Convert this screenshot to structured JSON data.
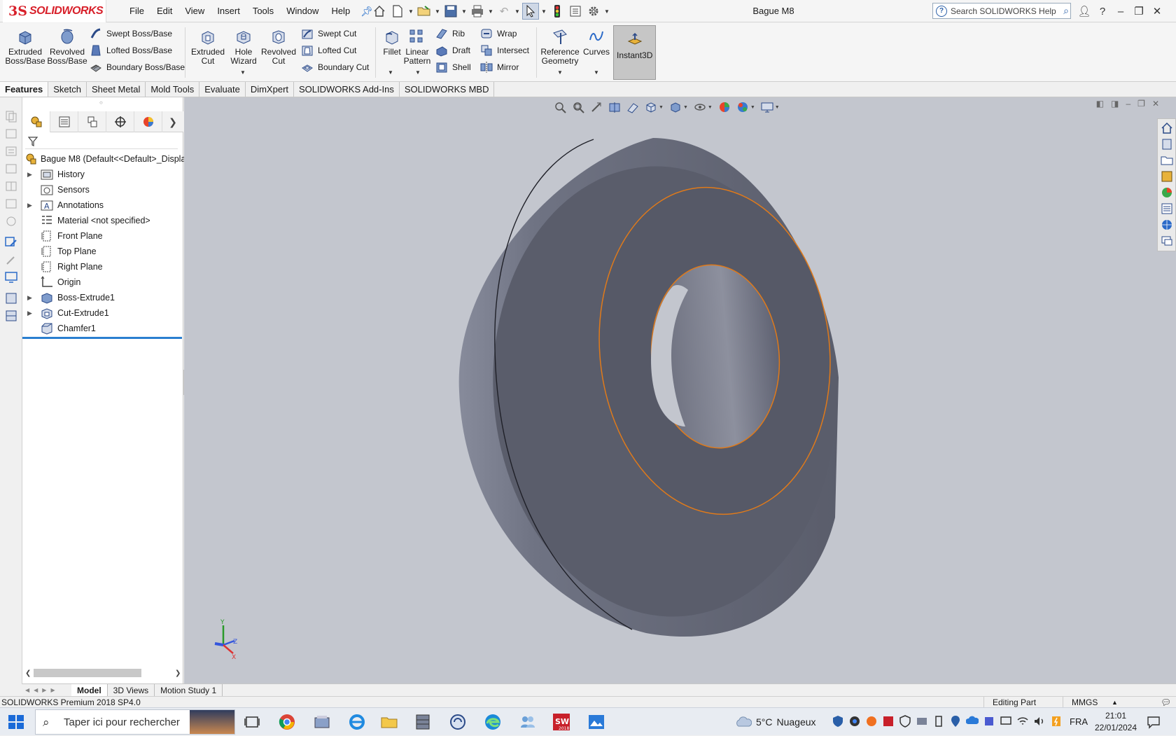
{
  "app": {
    "logo_ds": "3S",
    "logo_text": "SOLIDWORKS",
    "document_title": "Bague M8",
    "search_placeholder": "Search SOLIDWORKS Help"
  },
  "menu": [
    "File",
    "Edit",
    "View",
    "Insert",
    "Tools",
    "Window",
    "Help"
  ],
  "ribbon": {
    "extruded_boss": "Extruded Boss/Base",
    "revolved_boss": "Revolved Boss/Base",
    "swept_boss": "Swept Boss/Base",
    "lofted_boss": "Lofted Boss/Base",
    "boundary_boss": "Boundary Boss/Base",
    "extruded_cut": "Extruded Cut",
    "hole_wizard": "Hole Wizard",
    "revolved_cut": "Revolved Cut",
    "swept_cut": "Swept Cut",
    "lofted_cut": "Lofted Cut",
    "boundary_cut": "Boundary Cut",
    "fillet": "Fillet",
    "linear_pattern": "Linear Pattern",
    "rib": "Rib",
    "draft": "Draft",
    "shell": "Shell",
    "wrap": "Wrap",
    "intersect": "Intersect",
    "mirror": "Mirror",
    "reference_geometry": "Reference Geometry",
    "curves": "Curves",
    "instant3d": "Instant3D"
  },
  "tabs": [
    "Features",
    "Sketch",
    "Sheet Metal",
    "Mold Tools",
    "Evaluate",
    "DimXpert",
    "SOLIDWORKS Add-Ins",
    "SOLIDWORKS MBD"
  ],
  "tree": {
    "root": "Bague M8  (Default<<Default>_Displa",
    "items": [
      {
        "label": "History",
        "expandable": true
      },
      {
        "label": "Sensors",
        "expandable": false
      },
      {
        "label": "Annotations",
        "expandable": true
      },
      {
        "label": "Material <not specified>",
        "expandable": false
      },
      {
        "label": "Front Plane",
        "expandable": false
      },
      {
        "label": "Top Plane",
        "expandable": false
      },
      {
        "label": "Right Plane",
        "expandable": false
      },
      {
        "label": "Origin",
        "expandable": false
      },
      {
        "label": "Boss-Extrude1",
        "expandable": true
      },
      {
        "label": "Cut-Extrude1",
        "expandable": true
      },
      {
        "label": "Chamfer1",
        "expandable": false
      }
    ]
  },
  "bottom_tabs": [
    "Model",
    "3D Views",
    "Motion Study 1"
  ],
  "status": {
    "version": "SOLIDWORKS Premium 2018 SP4.0",
    "mode": "Editing Part",
    "units": "MMGS"
  },
  "taskbar": {
    "search_placeholder": "Taper ici pour rechercher",
    "weather_temp": "5°C",
    "weather_text": "Nuageux",
    "language": "FRA",
    "time": "21:01",
    "date": "22/01/2024"
  },
  "colors": {
    "brand": "#d8202a",
    "viewport": "#c3c6ce",
    "part": "#5a5d6b",
    "edge_highlight": "#e07a1a"
  }
}
